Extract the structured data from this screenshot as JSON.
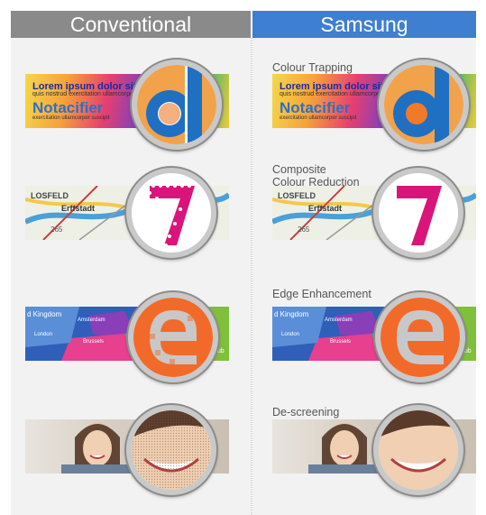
{
  "headers": {
    "left": "Conventional",
    "right": "Samsung"
  },
  "captions": {
    "trapping": "Colour Trapping",
    "composite_line1": "Composite",
    "composite_line2": "Colour Reduction",
    "edge": "Edge Enhancement",
    "descreening": "De-screening"
  },
  "banner_text": {
    "line1": "Lorem ipsum dolor sit met",
    "line2": "quis nostrud exercitation ullamcorper",
    "line3": "Notacifier",
    "line4": "exercitation ullamcorper suscipit"
  },
  "map_text": {
    "kingdom": "d Kingdom",
    "amsterdam": "Amsterdam",
    "london": "London",
    "brussels": "Brussels",
    "repub": "Repub",
    "road": "LOSFELD",
    "town": "Erffstadt",
    "num": "265"
  },
  "lens_glyphs": {
    "d": "d",
    "seven": "7",
    "e": "e"
  },
  "colors": {
    "header_left": "#8a8a8a",
    "header_right": "#3f7fd1",
    "blue": "#1f6fc2",
    "magenta": "#d9157b",
    "orange": "#f26a2a"
  }
}
